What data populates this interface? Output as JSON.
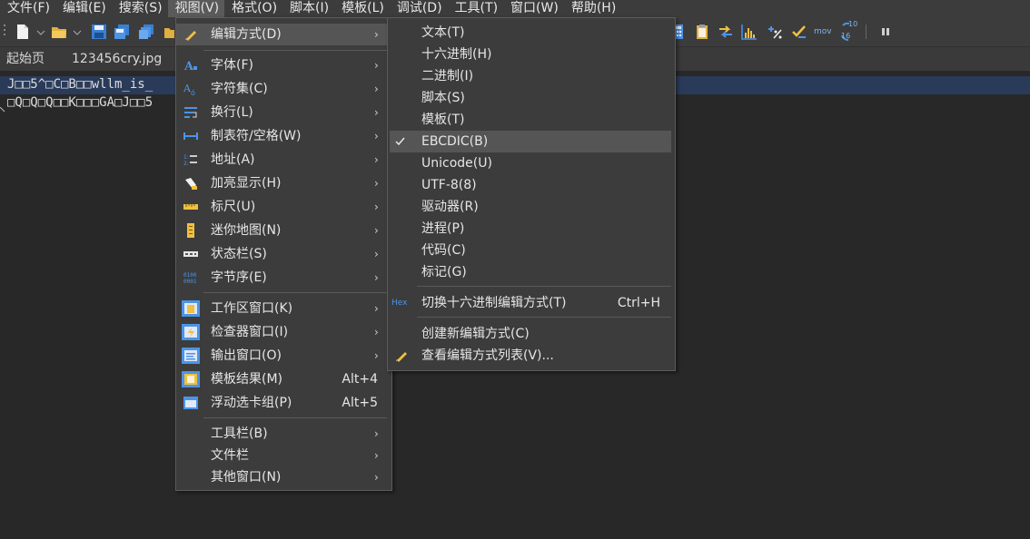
{
  "menubar": {
    "items": [
      {
        "label": "文件(F)"
      },
      {
        "label": "编辑(E)"
      },
      {
        "label": "搜索(S)"
      },
      {
        "label": "视图(V)",
        "active": true
      },
      {
        "label": "格式(O)"
      },
      {
        "label": "脚本(I)"
      },
      {
        "label": "模板(L)"
      },
      {
        "label": "调试(D)"
      },
      {
        "label": "工具(T)"
      },
      {
        "label": "窗口(W)"
      },
      {
        "label": "帮助(H)"
      }
    ]
  },
  "toolbar": {
    "mov_label": "mov",
    "num_top": "10",
    "num_bottom": "16"
  },
  "tabs": {
    "start": "起始页",
    "file": "123456cry.jpg"
  },
  "editor": {
    "line1": "J□□5^□C□B□□wllm_is_",
    "line2": "□Q□Q□Q□□K□□□GA□J□□5"
  },
  "view_menu": {
    "items": [
      {
        "label": "编辑方式(D)",
        "icon": "pencil-icon",
        "submenu": true,
        "highlight": true
      },
      {
        "label": "字体(F)",
        "icon": "font-icon",
        "submenu": true
      },
      {
        "label": "字符集(C)",
        "icon": "charset-icon",
        "submenu": true
      },
      {
        "label": "换行(L)",
        "icon": "wrap-icon",
        "submenu": true
      },
      {
        "label": "制表符/空格(W)",
        "icon": "tab-space-icon",
        "submenu": true
      },
      {
        "label": "地址(A)",
        "icon": "address-icon",
        "submenu": true
      },
      {
        "label": "加亮显示(H)",
        "icon": "highlighter-icon",
        "submenu": true
      },
      {
        "label": "标尺(U)",
        "icon": "ruler-icon",
        "submenu": true
      },
      {
        "label": "迷你地图(N)",
        "icon": "minimap-icon",
        "submenu": true
      },
      {
        "label": "状态栏(S)",
        "icon": "statusbar-icon",
        "submenu": true
      },
      {
        "label": "字节序(E)",
        "icon": "byte-order-icon",
        "submenu": true
      },
      {
        "label": "工作区窗口(K)",
        "icon": "workspace-icon",
        "submenu": true
      },
      {
        "label": "检查器窗口(I)",
        "icon": "inspector-icon",
        "submenu": true
      },
      {
        "label": "输出窗口(O)",
        "icon": "output-icon",
        "submenu": true
      },
      {
        "label": "模板结果(M)",
        "icon": "template-results-icon",
        "shortcut": "Alt+4"
      },
      {
        "label": "浮动选卡组(P)",
        "icon": "floating-tab-icon",
        "shortcut": "Alt+5"
      },
      {
        "label": "工具栏(B)",
        "submenu": true
      },
      {
        "label": "文件栏",
        "submenu": true
      },
      {
        "label": "其他窗口(N)",
        "submenu": true
      }
    ]
  },
  "edit_as_menu": {
    "items": [
      {
        "label": "文本(T)"
      },
      {
        "label": "十六进制(H)"
      },
      {
        "label": "二进制(I)"
      },
      {
        "label": "脚本(S)"
      },
      {
        "label": "模板(T)"
      },
      {
        "label": "EBCDIC(B)",
        "checked": true,
        "highlight": true
      },
      {
        "label": "Unicode(U)"
      },
      {
        "label": "UTF-8(8)"
      },
      {
        "label": "驱动器(R)"
      },
      {
        "label": "进程(P)"
      },
      {
        "label": "代码(C)"
      },
      {
        "label": "标记(G)"
      },
      {
        "label": "切换十六进制编辑方式(T)",
        "icon_text": "Hex",
        "shortcut": "Ctrl+H"
      },
      {
        "label": "创建新编辑方式(C)"
      },
      {
        "label": "查看编辑方式列表(V)...",
        "icon": "pencil-icon"
      }
    ]
  },
  "colors": {
    "menu_bg": "#3c3c3c",
    "highlight": "#555555",
    "editor_bg": "#282828",
    "selection": "#2a3b5a",
    "accent_blue": "#4a90d9"
  }
}
